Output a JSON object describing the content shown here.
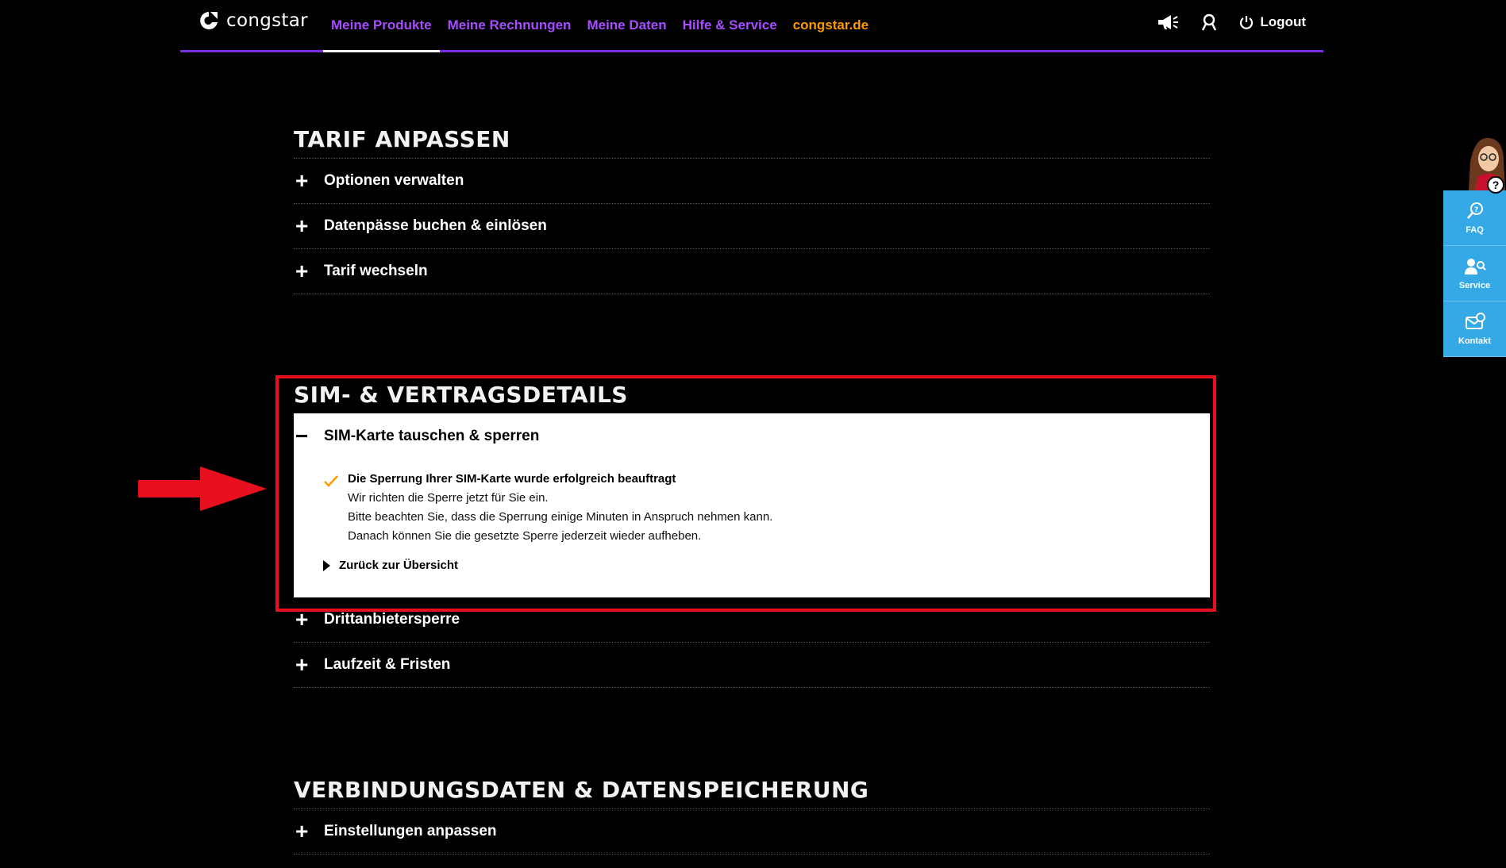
{
  "header": {
    "logo_text": "congstar",
    "nav": [
      {
        "label": "Meine Produkte"
      },
      {
        "label": "Meine Rechnungen"
      },
      {
        "label": "Meine Daten"
      },
      {
        "label": "Hilfe & Service"
      },
      {
        "label": "congstar.de"
      }
    ],
    "logout_label": "Logout",
    "colors": {
      "nav": "#a64dff",
      "external": "#ff9900",
      "underline": "#7a2ce0"
    }
  },
  "tarif": {
    "title": "TARIF ANPASSEN",
    "items": [
      {
        "label": "Optionen verwalten"
      },
      {
        "label": "Datenpässe buchen & einlösen"
      },
      {
        "label": "Tarif wechseln"
      }
    ]
  },
  "sim": {
    "title": "SIM- & VERTRAGSDETAILS",
    "expanded": {
      "label": "SIM-Karte tauschen & sperren",
      "message_title": "Die Sperrung Ihrer SIM-Karte wurde erfolgreich beauftragt",
      "lines": [
        "Wir richten die Sperre jetzt für Sie ein.",
        "Bitte beachten Sie, dass die Sperrung einige Minuten in Anspruch nehmen kann.",
        "Danach können Sie die gesetzte Sperre jederzeit wieder aufheben."
      ],
      "back_label": "Zurück zur Übersicht"
    },
    "items": [
      {
        "label": "Drittanbietersperre"
      },
      {
        "label": "Laufzeit & Fristen"
      }
    ]
  },
  "verbindung": {
    "title": "VERBINDUNGSDATEN & DATENSPEICHERUNG",
    "items": [
      {
        "label": "Einstellungen anpassen"
      }
    ]
  },
  "side": {
    "help": "?",
    "buttons": [
      {
        "label": "FAQ"
      },
      {
        "label": "Service"
      },
      {
        "label": "Kontakt"
      }
    ],
    "color": "#35a8e6"
  }
}
